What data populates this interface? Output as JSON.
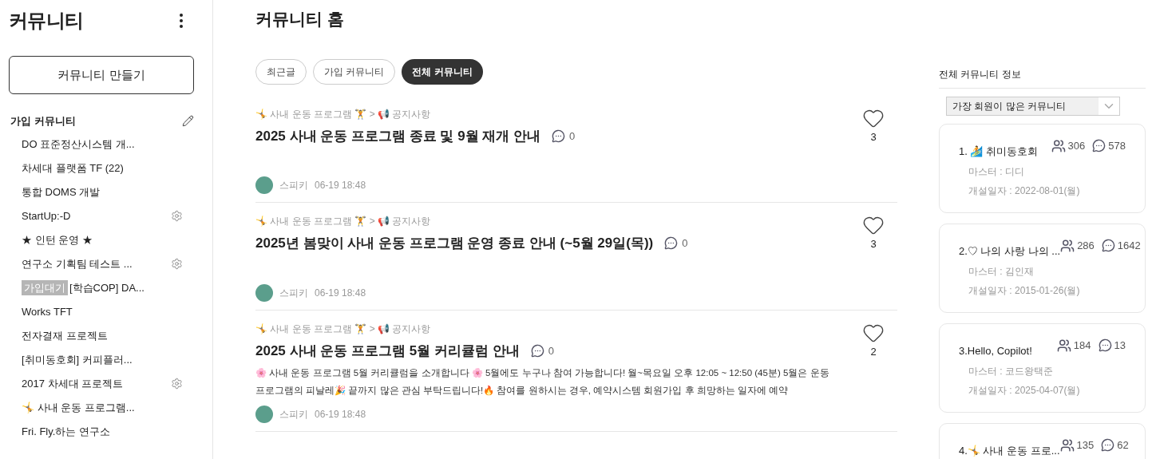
{
  "sidebar": {
    "title": "커뮤니티",
    "create_button": "커뮤니티 만들기",
    "section_title": "가입 커뮤니티",
    "items": [
      {
        "label": "DO 표준정산시스템 개...",
        "settings": false
      },
      {
        "label": "차세대 플랫폼 TF (22)",
        "settings": false
      },
      {
        "label": "통합 DOMS 개발",
        "settings": false
      },
      {
        "label": "StartUp:-D",
        "settings": true
      },
      {
        "label": "★ 인턴 운영 ★",
        "settings": false
      },
      {
        "label": "연구소 기획팀 테스트 ...",
        "settings": true
      },
      {
        "label": "[학습COP] DA...",
        "badge": "가입대기",
        "settings": false
      },
      {
        "label": "Works TFT",
        "settings": false
      },
      {
        "label": "전자결재 프로젝트",
        "settings": false
      },
      {
        "label": "[취미동호회] 커피플러...",
        "settings": false
      },
      {
        "label": "2017 차세대 프로젝트",
        "settings": true
      },
      {
        "label": "🤸 사내 운동 프로그램...",
        "settings": false
      },
      {
        "label": "Fri. Fly.하는 연구소",
        "settings": false
      }
    ]
  },
  "main": {
    "title": "커뮤니티 홈",
    "tabs": [
      {
        "label": "최근글",
        "selected": false
      },
      {
        "label": "가입 커뮤니티",
        "selected": false
      },
      {
        "label": "전체 커뮤니티",
        "selected": true
      }
    ],
    "posts": [
      {
        "breadcrumb": "🤸 사내 운동 프로그램 🏋 > 📢 공지사항",
        "title": "2025 사내 운동 프로그램 종료 및 9월 재개 안내",
        "comments": "0",
        "likes": "3",
        "author": "스피키",
        "date": "06-19 18:48"
      },
      {
        "breadcrumb": "🤸 사내 운동 프로그램 🏋 > 📢 공지사항",
        "title": "2025년 봄맞이 사내 운동 프로그램 운영 종료 안내 (~5월 29일(목))",
        "comments": "0",
        "likes": "3",
        "author": "스피키",
        "date": "06-19 18:48"
      },
      {
        "breadcrumb": "🤸 사내 운동 프로그램 🏋 > 📢 공지사항",
        "title": "2025 사내 운동 프로그램 5월 커리큘럼 안내",
        "comments": "0",
        "likes": "2",
        "preview": "🌸 사내 운동 프로그램 5월 커리큘럼을 소개합니다 🌸    5월에도 누구나 참여 가능합니다! 월~목요일 오후 12:05 ~ 12:50 (45분) 5월은 운동 프로그램의 피날레🎉 끝까지 많은 관심 부탁드립니다!🔥    참여를 원하시는 경우, 예약시스템 회원가입 후 희망하는 일자에 예약",
        "author": "스피키",
        "date": "06-19 18:48"
      }
    ]
  },
  "info": {
    "title": "전체 커뮤니티 정보",
    "sort_select": "가장 회원이 많은 커뮤니티",
    "communities": [
      {
        "name": "1. 🏄 취미동호회",
        "members": "306",
        "comments": "578",
        "master": "마스터 : 디디",
        "founded": "개설일자 : 2022-08-01(월)"
      },
      {
        "name": "2.♡ 나의 사랑 나의 ...",
        "members": "286",
        "comments": "1642",
        "master": "마스터 : 김인재",
        "founded": "개설일자 : 2015-01-26(월)"
      },
      {
        "name": "3.Hello, Copilot!",
        "members": "184",
        "comments": "13",
        "master": "마스터 : 코드왕택준",
        "founded": "개설일자 : 2025-04-07(월)"
      },
      {
        "name": "4.🤸 사내 운동 프로...",
        "members": "135",
        "comments": "62"
      }
    ]
  }
}
